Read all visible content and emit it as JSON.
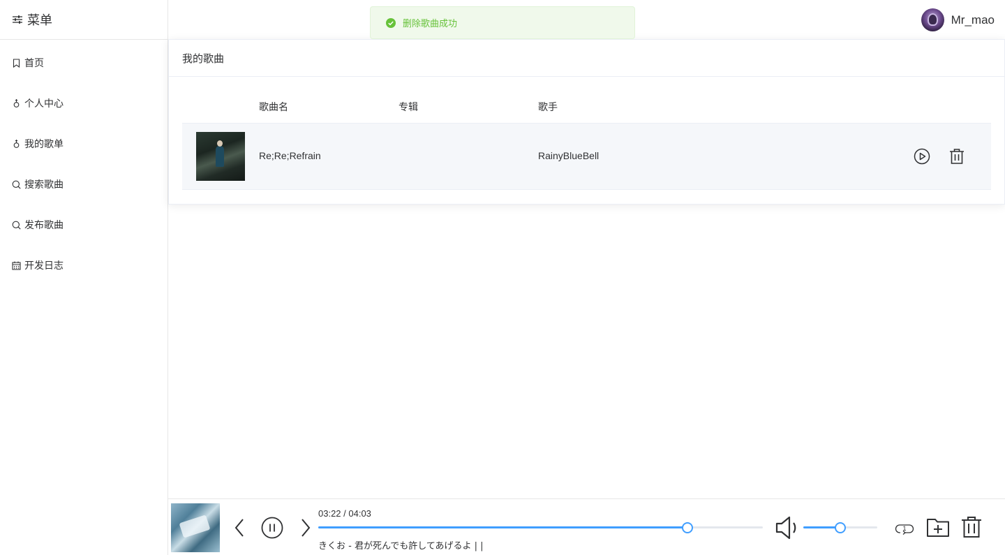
{
  "sidebar": {
    "title": "菜单",
    "items": [
      {
        "label": "首页",
        "icon": "bookmark-icon"
      },
      {
        "label": "个人中心",
        "icon": "male-icon"
      },
      {
        "label": "我的歌单",
        "icon": "male-icon"
      },
      {
        "label": "搜索歌曲",
        "icon": "search-icon"
      },
      {
        "label": "发布歌曲",
        "icon": "search-icon"
      },
      {
        "label": "开发日志",
        "icon": "calendar-icon"
      }
    ]
  },
  "header": {
    "username": "Mr_mao"
  },
  "toast": {
    "message": "删除歌曲成功",
    "type": "success",
    "color": "#67c23a"
  },
  "card": {
    "title": "我的歌曲",
    "columns": [
      "歌曲名",
      "专辑",
      "歌手"
    ],
    "rows": [
      {
        "name": "Re;Re;Refrain",
        "album": "",
        "artist": "RainyBlueBell"
      }
    ]
  },
  "player": {
    "time": "03:22 / 04:03",
    "progress": 0.83,
    "volume": 0.5,
    "lyric": "きくお - 君が死んでも許してあげるよ | |",
    "loop_count": "1",
    "accent": "#409eff"
  }
}
